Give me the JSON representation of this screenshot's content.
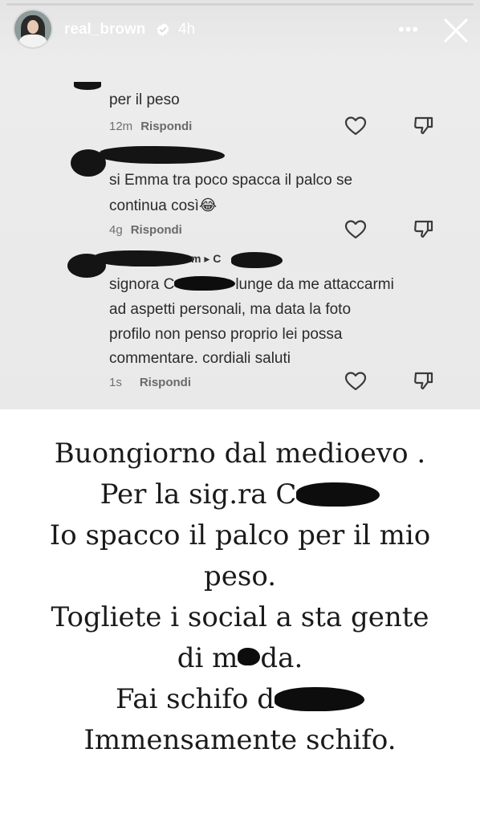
{
  "story": {
    "username": "real_brown",
    "time_ago": "4h",
    "more_label": "•••"
  },
  "comments": [
    {
      "text": "per il peso",
      "time": "12m",
      "reply": "Rispondi"
    },
    {
      "text_line1": "si Emma tra poco spacca il palco se",
      "text_line2": "continua così😂",
      "time": "4g",
      "reply": "Rispondi"
    },
    {
      "author_suffix": "m ▸ C",
      "text_line1a": "signora C",
      "text_line1b": "lunge da me attaccarmi",
      "text_line2": "ad aspetti personali, ma data la foto",
      "text_line3": "profilo non penso proprio lei possa",
      "text_line4": "commentare. cordiali saluti",
      "time": "1s",
      "reply": "Rispondi"
    }
  ],
  "caption": {
    "line1": "Buongiorno dal medioevo .",
    "line2": "Per la sig.ra C",
    "line3": "Io spacco il palco per il mio",
    "line4": "peso.",
    "line5": "Togliete i social a sta gente",
    "line6a": "di m",
    "line6b": "da.",
    "line7": "Fai schifo d",
    "line8": "Immensamente schifo."
  }
}
